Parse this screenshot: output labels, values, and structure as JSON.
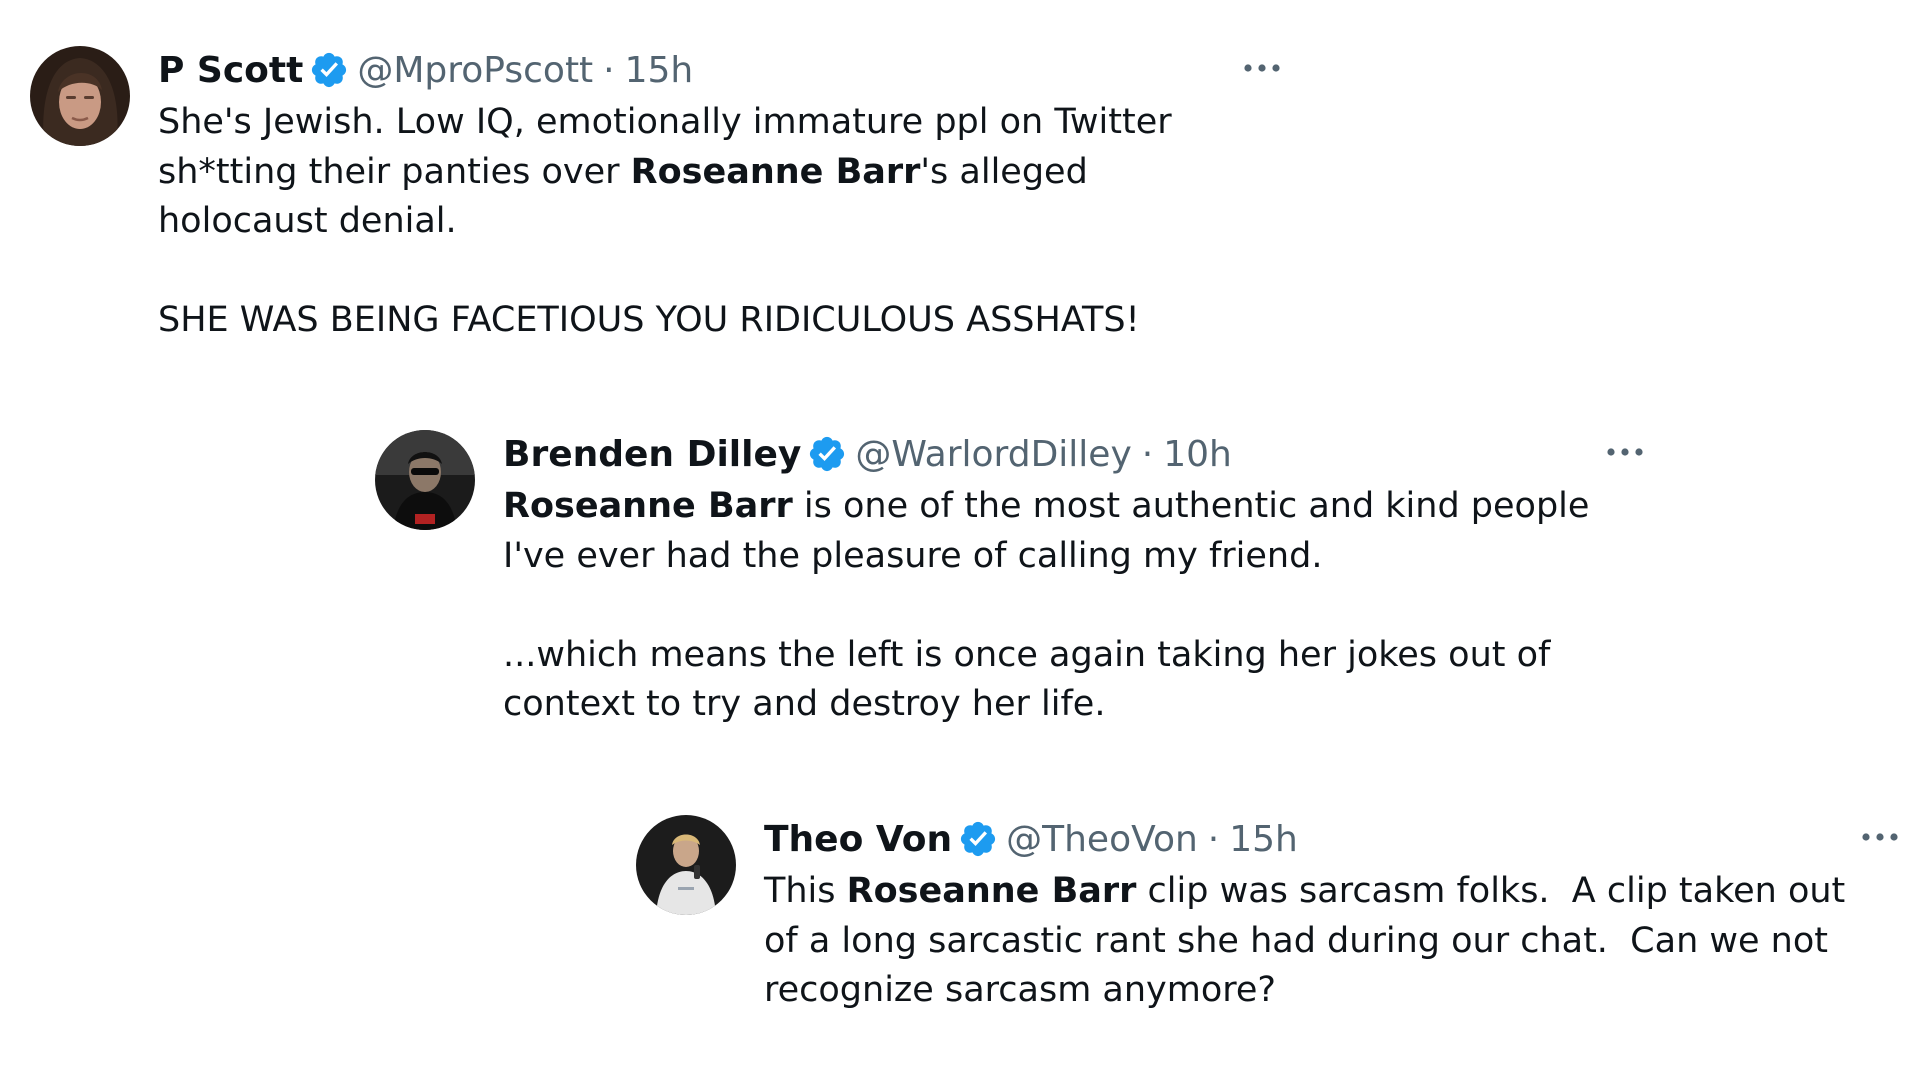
{
  "tweets": [
    {
      "name": "P Scott",
      "handle": "@MproPscott",
      "separator": "·",
      "time": "15h",
      "verified_icon": "verified-badge-icon",
      "more_icon": "more-options-icon",
      "paragraphs": [
        [
          {
            "text": "She's Jewish. Low IQ, emotionally immature ppl on Twitter sh*tting their panties over "
          },
          {
            "text": "Roseanne Barr",
            "bold": true
          },
          {
            "text": "'s alleged holocaust denial."
          }
        ],
        [
          {
            "text": "SHE WAS BEING FACETIOUS YOU RIDICULOUS ASSHATS!"
          }
        ]
      ]
    },
    {
      "name": "Brenden Dilley",
      "handle": "@WarlordDilley",
      "separator": "·",
      "time": "10h",
      "verified_icon": "verified-badge-icon",
      "more_icon": "more-options-icon",
      "paragraphs": [
        [
          {
            "text": "Roseanne Barr",
            "bold": true
          },
          {
            "text": " is one of the most authentic and kind people I've ever had the pleasure of calling my friend."
          }
        ],
        [
          {
            "text": "...which means the left is once again taking her jokes out of context to try and destroy her life."
          }
        ]
      ]
    },
    {
      "name": "Theo Von",
      "handle": "@TheoVon",
      "separator": "·",
      "time": "15h",
      "verified_icon": "verified-badge-icon",
      "more_icon": "more-options-icon",
      "paragraphs": [
        [
          {
            "text": "This "
          },
          {
            "text": "Roseanne Barr",
            "bold": true
          },
          {
            "text": " clip was sarcasm folks.  A clip taken out of a long sarcastic rant she had during our chat.  Can we not recognize sarcasm anymore?"
          }
        ]
      ]
    }
  ],
  "colors": {
    "text": "#0f1419",
    "secondary": "#536471",
    "verified": "#1d9bf0",
    "background": "#ffffff"
  }
}
